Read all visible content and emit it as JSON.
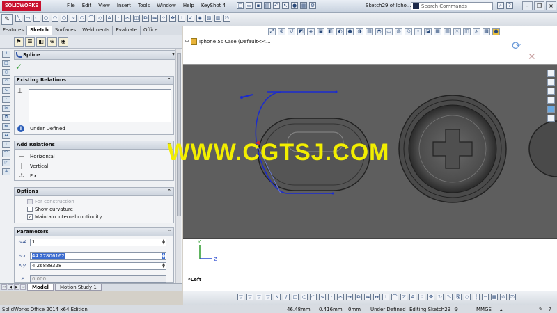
{
  "app": {
    "logo": "SOLIDWORKS",
    "doc_title": "Sketch29 of Ipho...",
    "search_placeholder": "Search Commands",
    "help": "?"
  },
  "menu": [
    "File",
    "Edit",
    "View",
    "Insert",
    "Tools",
    "Window",
    "Help",
    "KeyShot 4"
  ],
  "feature_tabs": [
    "Features",
    "Sketch",
    "Surfaces",
    "Weldments",
    "Evaluate",
    "Office Products"
  ],
  "active_tab": "Sketch",
  "property_manager": {
    "title": "Spline",
    "help": "?",
    "ok": "✓",
    "existing_relations": {
      "header": "Existing Relations",
      "status": "Under Defined"
    },
    "add_relations": {
      "header": "Add Relations",
      "items": [
        "Horizontal",
        "Vertical",
        "Fix"
      ]
    },
    "options": {
      "header": "Options",
      "items": [
        {
          "label": "For construction",
          "checked": false,
          "enabled": false
        },
        {
          "label": "Show curvature",
          "checked": false,
          "enabled": true
        },
        {
          "label": "Maintain internal continuity",
          "checked": true,
          "enabled": true
        }
      ]
    },
    "parameters": {
      "header": "Parameters",
      "fields": [
        "1",
        "44.27806162",
        "4.26888328",
        "0.000"
      ]
    }
  },
  "bottom_tabs": [
    "Model",
    "Motion Study 1"
  ],
  "viewport": {
    "tree_label": "Iphone 5s Case  (Default<<...",
    "view_name": "*Left",
    "axis_x": "Z",
    "axis_y": "Y"
  },
  "watermark": "WWW.CGTSJ.COM",
  "status_bar": {
    "edition": "SolidWorks Office 2014 x64 Edition",
    "x": "46.48mm",
    "y": "0.416mm",
    "z": "0mm",
    "defined": "Under Defined",
    "editing": "Editing Sketch29",
    "units": "MMGS"
  },
  "colors": {
    "model_body": "#5e5e5e",
    "sketch_spline": "#1a2ad0",
    "watermark": "#f2ee00",
    "logo_red": "#c8102e"
  }
}
